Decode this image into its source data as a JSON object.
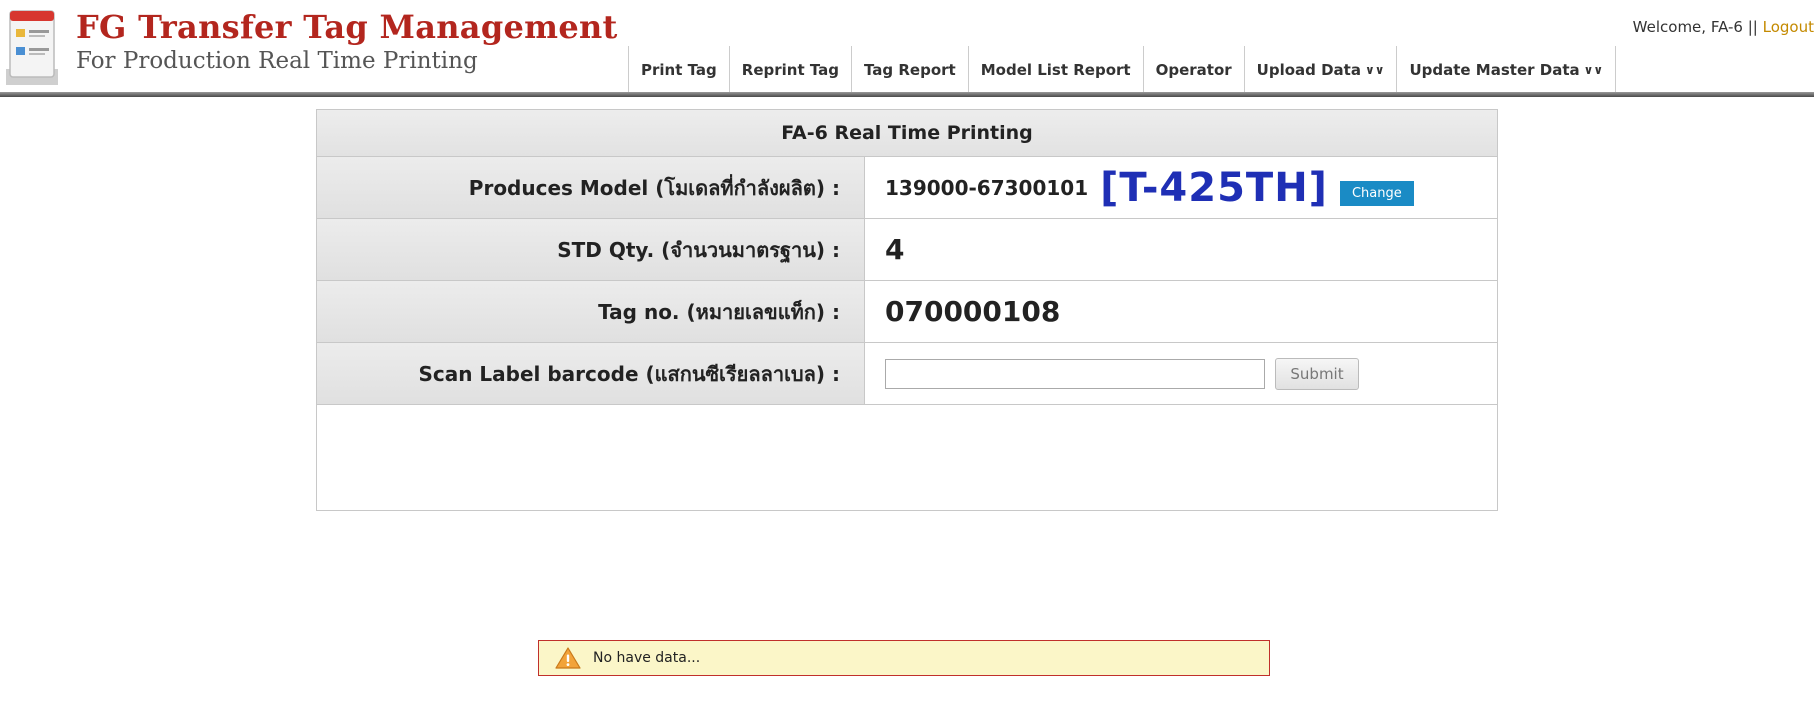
{
  "header": {
    "title": "FG Transfer Tag  Management",
    "subtitle": "For Production Real Time Printing",
    "welcome_text": "Welcome, FA-6",
    "separator": "||",
    "logout_label": "Logout",
    "logo_icon": "document-list-icon"
  },
  "nav": {
    "items": [
      {
        "label": "Print Tag"
      },
      {
        "label": "Reprint Tag"
      },
      {
        "label": "Tag Report"
      },
      {
        "label": "Model List Report"
      },
      {
        "label": "Operator"
      },
      {
        "label": "Upload Data",
        "dropdown": true
      },
      {
        "label": "Update Master Data",
        "dropdown": true
      }
    ],
    "dropdown_glyph": "∨∨"
  },
  "panel": {
    "title": "FA-6 Real Time Printing",
    "rows": {
      "model": {
        "label": "Produces Model (โมเดลที่กำลังผลิต) :",
        "code": "139000-67300101",
        "name": "[T-425TH]",
        "change_label": "Change"
      },
      "std_qty": {
        "label": "STD Qty. (จำนวนมาตรฐาน) :",
        "value": "4"
      },
      "tag_no": {
        "label": "Tag no. (หมายเลขแท็ก) :",
        "value": "070000108"
      },
      "scan": {
        "label": "Scan Label barcode (แสกนซีเรียลลาเบล) :",
        "input_value": "",
        "submit_label": "Submit"
      }
    }
  },
  "alert": {
    "icon": "warning-icon",
    "message": "No have data..."
  },
  "colors": {
    "title_red": "#b3261e",
    "model_blue": "#1f2fb5",
    "change_button": "#1a8bc5",
    "logout_link": "#c48a00",
    "alert_bg": "#fbf6c8",
    "alert_border": "#c0302b"
  }
}
